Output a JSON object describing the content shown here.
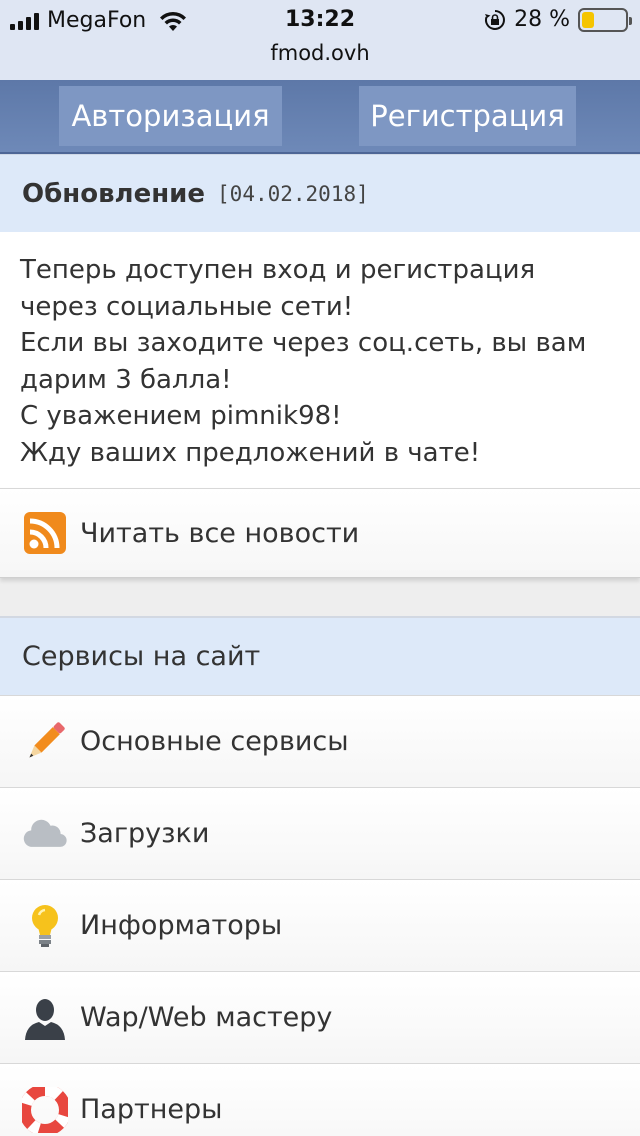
{
  "status_bar": {
    "carrier": "MegaFon",
    "time": "13:22",
    "battery_percent": "28 %",
    "battery_level": 0.28,
    "url": "fmod.ovh"
  },
  "auth": {
    "login_label": "Авторизация",
    "register_label": "Регистрация"
  },
  "news": {
    "title": "Обновление",
    "date": "[04.02.2018]",
    "lines": [
      "Теперь доступен вход и регистрация",
      "через социальные сети!",
      "Если вы заходите через соц.сеть, вы вам",
      "дарим 3 балла!",
      "С уважением pimnik98!",
      "Жду ваших предложений в чате!"
    ],
    "read_all_label": "Читать все новости",
    "read_all_icon": "rss-icon"
  },
  "services": {
    "title": "Сервисы на сайт",
    "items": [
      {
        "label": "Основные сервисы",
        "icon": "pencil-icon"
      },
      {
        "label": "Загрузки",
        "icon": "cloud-icon"
      },
      {
        "label": "Информаторы",
        "icon": "lightbulb-icon"
      },
      {
        "label": "Wap/Web мастеру",
        "icon": "user-icon"
      },
      {
        "label": "Партнеры",
        "icon": "lifebuoy-icon"
      }
    ]
  },
  "colors": {
    "auth_bar": "#5d78a8",
    "auth_button": "#7e97c3",
    "section_header": "#dde9f9",
    "battery": "#f5c400",
    "rss": "#f08a1c"
  }
}
